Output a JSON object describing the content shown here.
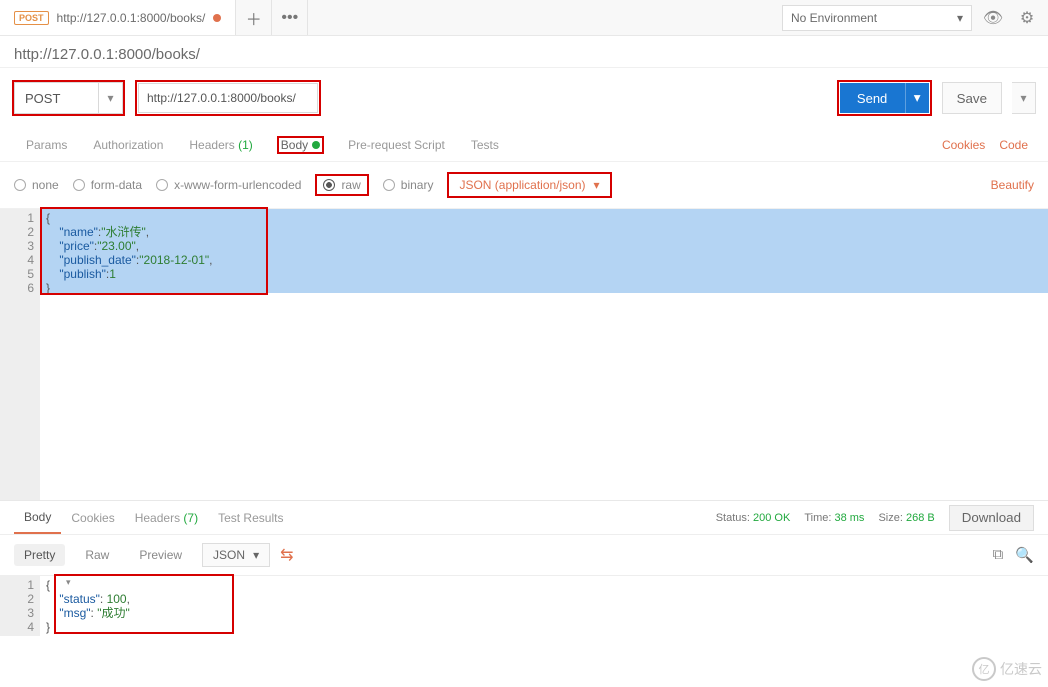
{
  "top": {
    "tab_method": "POST",
    "tab_title": "http://127.0.0.1:8000/books/",
    "env_label": "No Environment"
  },
  "header": {
    "title": "http://127.0.0.1:8000/books/"
  },
  "request": {
    "method": "POST",
    "url": "http://127.0.0.1:8000/books/",
    "send_label": "Send",
    "save_label": "Save"
  },
  "tabs": {
    "params": "Params",
    "authorization": "Authorization",
    "headers": "Headers",
    "headers_count": "(1)",
    "body": "Body",
    "prerequest": "Pre-request Script",
    "tests": "Tests",
    "cookies": "Cookies",
    "code": "Code"
  },
  "body_types": {
    "none": "none",
    "form_data": "form-data",
    "xwww": "x-www-form-urlencoded",
    "raw": "raw",
    "binary": "binary",
    "json_type": "JSON (application/json)",
    "beautify": "Beautify"
  },
  "request_body": {
    "raw_text": "{\n    \"name\":\"水浒传\",\n    \"price\":\"23.00\",\n    \"publish_date\":\"2018-12-01\",\n    \"publish\":1\n}",
    "lines": [
      "1",
      "2",
      "3",
      "4",
      "5",
      "6"
    ],
    "tokens": [
      [
        {
          "t": "p",
          "v": "{"
        }
      ],
      [
        {
          "t": "p",
          "v": "    "
        },
        {
          "t": "k",
          "v": "\"name\""
        },
        {
          "t": "p",
          "v": ":"
        },
        {
          "t": "s",
          "v": "\"水浒传\""
        },
        {
          "t": "p",
          "v": ","
        }
      ],
      [
        {
          "t": "p",
          "v": "    "
        },
        {
          "t": "k",
          "v": "\"price\""
        },
        {
          "t": "p",
          "v": ":"
        },
        {
          "t": "s",
          "v": "\"23.00\""
        },
        {
          "t": "p",
          "v": ","
        }
      ],
      [
        {
          "t": "p",
          "v": "    "
        },
        {
          "t": "k",
          "v": "\"publish_date\""
        },
        {
          "t": "p",
          "v": ":"
        },
        {
          "t": "s",
          "v": "\"2018-12-01\""
        },
        {
          "t": "p",
          "v": ","
        }
      ],
      [
        {
          "t": "p",
          "v": "    "
        },
        {
          "t": "k",
          "v": "\"publish\""
        },
        {
          "t": "p",
          "v": ":"
        },
        {
          "t": "n",
          "v": "1"
        }
      ],
      [
        {
          "t": "p",
          "v": "}"
        }
      ]
    ]
  },
  "response_tabs": {
    "body": "Body",
    "cookies": "Cookies",
    "headers": "Headers",
    "headers_count": "(7)",
    "test_results": "Test Results"
  },
  "response_meta": {
    "status_label": "Status:",
    "status_value": "200 OK",
    "time_label": "Time:",
    "time_value": "38 ms",
    "size_label": "Size:",
    "size_value": "268 B",
    "download": "Download"
  },
  "response_view": {
    "pretty": "Pretty",
    "raw": "Raw",
    "preview": "Preview",
    "format": "JSON"
  },
  "response_body": {
    "raw_text": "{\n    \"status\": 100,\n    \"msg\": \"成功\"\n}",
    "lines": [
      "1",
      "2",
      "3",
      "4"
    ],
    "tokens": [
      [
        {
          "t": "p",
          "v": "{"
        }
      ],
      [
        {
          "t": "p",
          "v": "    "
        },
        {
          "t": "k",
          "v": "\"status\""
        },
        {
          "t": "p",
          "v": ": "
        },
        {
          "t": "n",
          "v": "100"
        },
        {
          "t": "p",
          "v": ","
        }
      ],
      [
        {
          "t": "p",
          "v": "    "
        },
        {
          "t": "k",
          "v": "\"msg\""
        },
        {
          "t": "p",
          "v": ": "
        },
        {
          "t": "s",
          "v": "\"成功\""
        }
      ],
      [
        {
          "t": "p",
          "v": "}"
        }
      ]
    ]
  },
  "watermark": "亿速云"
}
